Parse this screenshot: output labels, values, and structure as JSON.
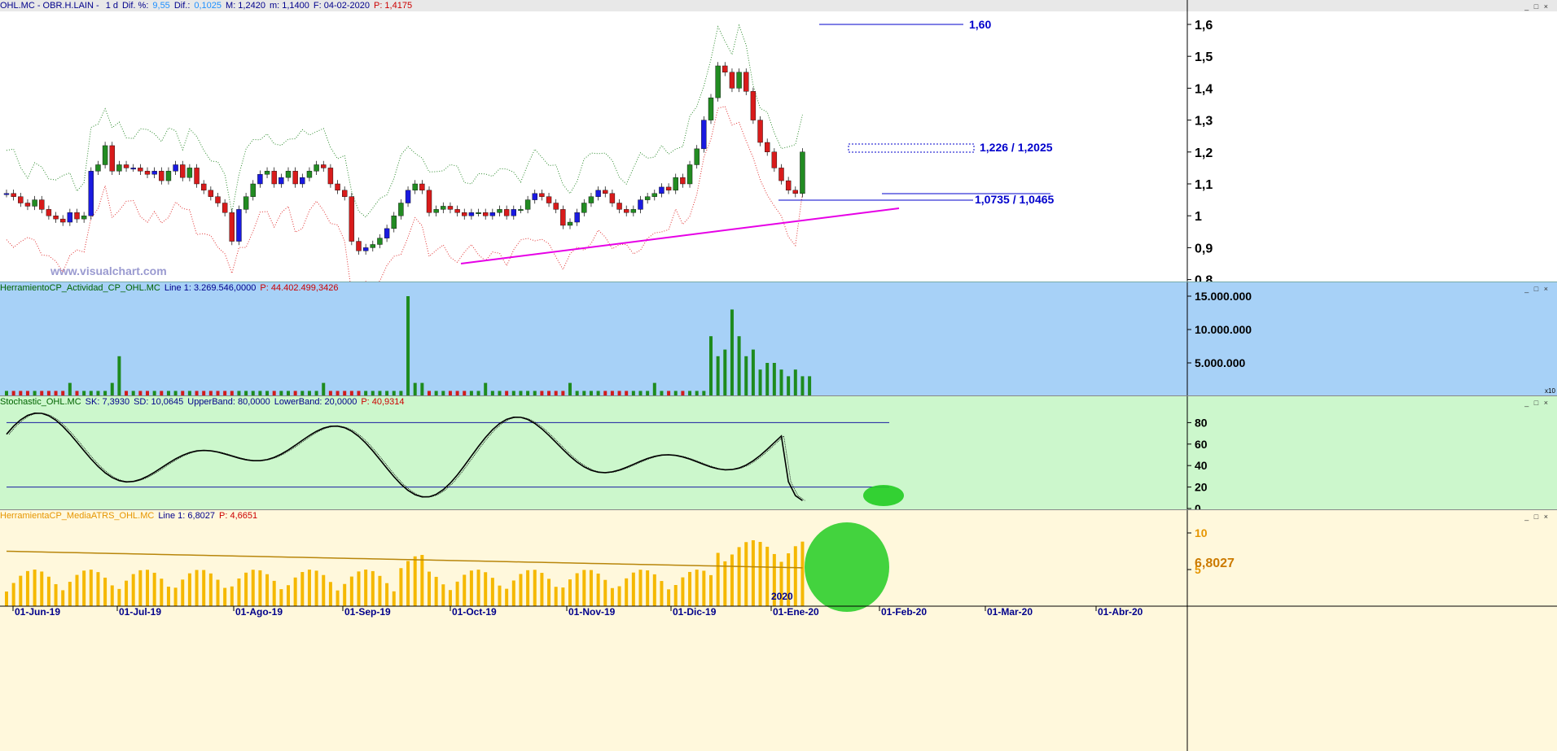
{
  "price_panel": {
    "header": [
      {
        "text": "OHL.MC - OBR.H.LAIN - ",
        "color": "#00008b"
      },
      {
        "text": "1 d",
        "color": "#00008b"
      },
      {
        "text": "Dif. %:",
        "color": "#00008b"
      },
      {
        "text": "9,55",
        "color": "#1e90ff"
      },
      {
        "text": "Dif.:",
        "color": "#00008b"
      },
      {
        "text": "0,1025",
        "color": "#1e90ff"
      },
      {
        "text": "M: 1,2420",
        "color": "#00008b"
      },
      {
        "text": "m: 1,1400",
        "color": "#00008b"
      },
      {
        "text": "F: 04-02-2020",
        "color": "#00008b"
      },
      {
        "text": "P: 1,4175",
        "color": "#cc0000"
      }
    ],
    "watermark": "www.visualchart.com",
    "yticks": [
      "1,6",
      "1,5",
      "1,4",
      "1,3",
      "1,2",
      "1,1",
      "1",
      "0,9",
      "0,8"
    ],
    "annotations": {
      "a1": "1,60",
      "a2": "1,226 / 1,2025",
      "a3": "1,0735 / 1,0465"
    }
  },
  "volume_panel": {
    "header": [
      {
        "text": "HerramientoCP_Actividad_CP_OHL.MC",
        "color": "#006400"
      },
      {
        "text": "Line 1: 3.269.546,0000",
        "color": "#00008b"
      },
      {
        "text": "P: 44.402.499,3426",
        "color": "#cc0000"
      }
    ],
    "yticks": [
      "15.000.000",
      "10.000.000",
      "5.000.000"
    ],
    "scale_badge": "x10"
  },
  "stoch_panel": {
    "header": [
      {
        "text": "Stochastic_OHL.MC",
        "color": "#006400"
      },
      {
        "text": "SK: 7,3930",
        "color": "#00008b"
      },
      {
        "text": "SD: 10,0645",
        "color": "#00008b"
      },
      {
        "text": "UpperBand: 80,0000",
        "color": "#00008b"
      },
      {
        "text": "LowerBand: 20,0000",
        "color": "#00008b"
      },
      {
        "text": "P: 40,9314",
        "color": "#cc0000"
      }
    ],
    "yticks": [
      "80",
      "60",
      "40",
      "20",
      "0"
    ]
  },
  "atr_panel": {
    "header": [
      {
        "text": "HerramientaCP_MediaATRS_OHL.MC",
        "color": "#e69500"
      },
      {
        "text": "Line 1: 6,8027",
        "color": "#00008b"
      },
      {
        "text": "P: 4,6651",
        "color": "#cc0000"
      }
    ],
    "yticks": [
      "10",
      "5"
    ],
    "last_value": "6,8027"
  },
  "xaxis": {
    "labels": [
      "01-Jun-19",
      "01-Jul-19",
      "01-Ago-19",
      "01-Sep-19",
      "01-Oct-19",
      "01-Nov-19",
      "01-Dic-19",
      "01-Ene-20",
      "01-Feb-20",
      "01-Mar-20",
      "01-Abr-20"
    ],
    "year_label": "2020"
  },
  "chart_data": [
    {
      "type": "candlestick",
      "title": "OHL.MC - OBR.H.LAIN - 1 d",
      "ylim": [
        0.8,
        1.65
      ],
      "closes": [
        1.07,
        1.06,
        1.04,
        1.03,
        1.05,
        1.02,
        1.0,
        0.99,
        0.98,
        1.01,
        0.99,
        1.0,
        1.14,
        1.16,
        1.22,
        1.14,
        1.16,
        1.15,
        1.15,
        1.14,
        1.13,
        1.14,
        1.11,
        1.14,
        1.16,
        1.12,
        1.15,
        1.1,
        1.08,
        1.06,
        1.04,
        1.01,
        0.92,
        1.02,
        1.06,
        1.1,
        1.13,
        1.14,
        1.1,
        1.12,
        1.14,
        1.1,
        1.12,
        1.14,
        1.16,
        1.15,
        1.1,
        1.08,
        1.06,
        0.92,
        0.89,
        0.9,
        0.91,
        0.93,
        0.96,
        1.0,
        1.04,
        1.08,
        1.1,
        1.08,
        1.01,
        1.02,
        1.03,
        1.02,
        1.01,
        1.0,
        1.01,
        1.01,
        1.0,
        1.01,
        1.02,
        1.0,
        1.02,
        1.02,
        1.05,
        1.07,
        1.06,
        1.04,
        1.02,
        0.97,
        0.98,
        1.01,
        1.04,
        1.06,
        1.08,
        1.07,
        1.04,
        1.02,
        1.01,
        1.02,
        1.05,
        1.06,
        1.07,
        1.09,
        1.08,
        1.12,
        1.1,
        1.16,
        1.21,
        1.3,
        1.37,
        1.47,
        1.45,
        1.4,
        1.45,
        1.39,
        1.3,
        1.23,
        1.2,
        1.15,
        1.11,
        1.08,
        1.07,
        1.2
      ],
      "upper_band_last": 1.3,
      "lower_band_last": 0.95
    },
    {
      "type": "bar",
      "title": "HerramientoCP_Actividad_CP_OHL.MC",
      "ylim": [
        0,
        15500000
      ],
      "values": [
        1,
        1,
        1,
        1,
        1,
        1,
        1,
        1,
        1,
        2,
        1,
        1,
        1,
        1,
        1,
        2,
        6,
        1,
        1,
        1,
        1,
        1,
        1,
        1,
        1,
        1,
        1,
        1,
        1,
        1,
        1,
        1,
        1,
        1,
        1,
        1,
        1,
        1,
        1,
        1,
        1,
        1,
        1,
        1,
        1,
        2,
        1,
        1,
        1,
        1,
        1,
        1,
        1,
        1,
        1,
        1,
        1,
        15,
        2,
        2,
        1,
        1,
        1,
        1,
        1,
        1,
        1,
        1,
        2,
        1,
        1,
        1,
        1,
        1,
        1,
        1,
        1,
        1,
        1,
        1,
        2,
        1,
        1,
        1,
        1,
        1,
        1,
        1,
        1,
        1,
        1,
        1,
        2,
        1,
        1,
        1,
        1,
        1,
        1,
        1,
        9,
        6,
        7,
        13,
        9,
        6,
        7,
        4,
        5,
        5,
        4,
        3,
        4,
        3,
        3
      ]
    },
    {
      "type": "line",
      "title": "Stochastic_OHL.MC",
      "ylim": [
        0,
        100
      ],
      "upper_band": 80,
      "lower_band": 20,
      "sk_last": 7.393,
      "sd_last": 10.0645
    },
    {
      "type": "bar",
      "title": "HerramientaCP_MediaATRS_OHL.MC",
      "ylim": [
        0,
        12
      ],
      "line_last": 6.8027
    }
  ]
}
